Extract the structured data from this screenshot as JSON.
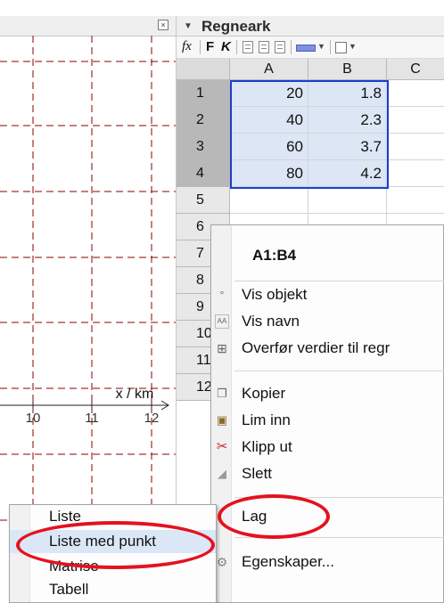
{
  "graphics_view": {
    "close_icon": "close-icon",
    "close_glyph": "×",
    "axis_label": "x / km",
    "x_ticks": [
      "10",
      "11",
      "12"
    ]
  },
  "spreadsheet": {
    "title": "Regneark",
    "collapse_icon": "triangle-down-icon",
    "toolbar": {
      "fx": "fx",
      "bold": "F",
      "italic": "K"
    },
    "columns": [
      "A",
      "B",
      "C"
    ],
    "rows": [
      {
        "num": "1",
        "a": "20",
        "b": "1.8"
      },
      {
        "num": "2",
        "a": "40",
        "b": "2.3"
      },
      {
        "num": "3",
        "a": "60",
        "b": "3.7"
      },
      {
        "num": "4",
        "a": "80",
        "b": "4.2"
      },
      {
        "num": "5"
      },
      {
        "num": "6"
      },
      {
        "num": "7"
      },
      {
        "num": "8"
      },
      {
        "num": "9"
      },
      {
        "num": "10"
      },
      {
        "num": "11"
      },
      {
        "num": "12"
      }
    ],
    "selection_color": "#1a3fd1"
  },
  "context_menu": {
    "title": "A1:B4",
    "items": [
      {
        "label": "Vis objekt",
        "icon": "show-object-icon"
      },
      {
        "label": "Vis navn",
        "icon": "show-label-icon"
      },
      {
        "label": "Overfør verdier til regr",
        "icon": "table-icon"
      },
      {
        "label": "Kopier",
        "icon": "copy-icon"
      },
      {
        "label": "Lim inn",
        "icon": "paste-icon"
      },
      {
        "label": "Klipp ut",
        "icon": "scissors-icon"
      },
      {
        "label": "Slett",
        "icon": "eraser-icon"
      },
      {
        "label": "Lag",
        "icon": ""
      },
      {
        "label": "Egenskaper...",
        "icon": "gear-icon"
      }
    ]
  },
  "submenu": {
    "items": [
      {
        "label": "Liste"
      },
      {
        "label": "Liste med punkt"
      },
      {
        "label": "Matrise"
      },
      {
        "label": "Tabell"
      }
    ]
  },
  "annotation_color": "#e4121f"
}
